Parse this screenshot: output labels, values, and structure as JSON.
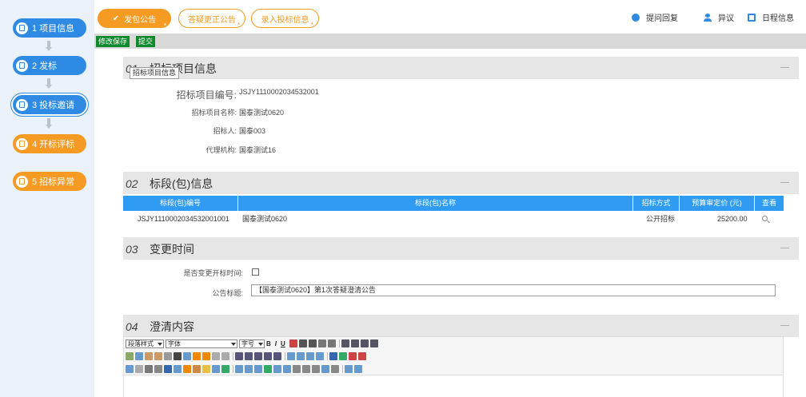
{
  "sidebar": {
    "steps": [
      {
        "label": "1 项目信息"
      },
      {
        "label": "2 发标"
      },
      {
        "label": "3 投标邀请"
      },
      {
        "label": "4 开标评标"
      },
      {
        "label": "5 招标异常"
      }
    ]
  },
  "top_tabs": [
    {
      "label": "发包公告",
      "check": "✔",
      "star": "*"
    },
    {
      "label": "答疑更正公告",
      "star": "*"
    },
    {
      "label": "录入投标信息",
      "star": "*"
    }
  ],
  "top_right": {
    "reply": "提问回复",
    "objection": "异议",
    "schedule": "日程信息"
  },
  "actions": {
    "save": "修改保存",
    "submit": "提交"
  },
  "sections": [
    {
      "num": "01",
      "title": "招标项目信息"
    },
    {
      "num": "02",
      "title": "标段(包)信息"
    },
    {
      "num": "03",
      "title": "变更时间"
    },
    {
      "num": "04",
      "title": "澄清内容"
    }
  ],
  "tooltip": "招标项目信息",
  "project": {
    "code_label": "招标项目编号:",
    "code": "JSJY1110002034532001",
    "name_label": "招标项目名称:",
    "name": "国泰测试0620",
    "tenderer_label": "招标人:",
    "tenderer": "国泰003",
    "agency_label": "代理机构:",
    "agency": "国泰测试16"
  },
  "table": {
    "headers": [
      "标段(包)编号",
      "标段(包)名称",
      "招标方式",
      "预算审定价 (元)",
      "查看"
    ],
    "row": [
      "JSJY1110002034532001001",
      "国泰测试0620",
      "公开招标",
      "25200.00"
    ]
  },
  "change": {
    "change_open_label": "是否变更开标时间:",
    "title_label": "公告标题:",
    "title_value": "【国泰测试0620】第1次答疑澄清公告"
  },
  "editor": {
    "paragraph_style": "段落样式",
    "font_family": "字体",
    "font_size": "字号"
  }
}
